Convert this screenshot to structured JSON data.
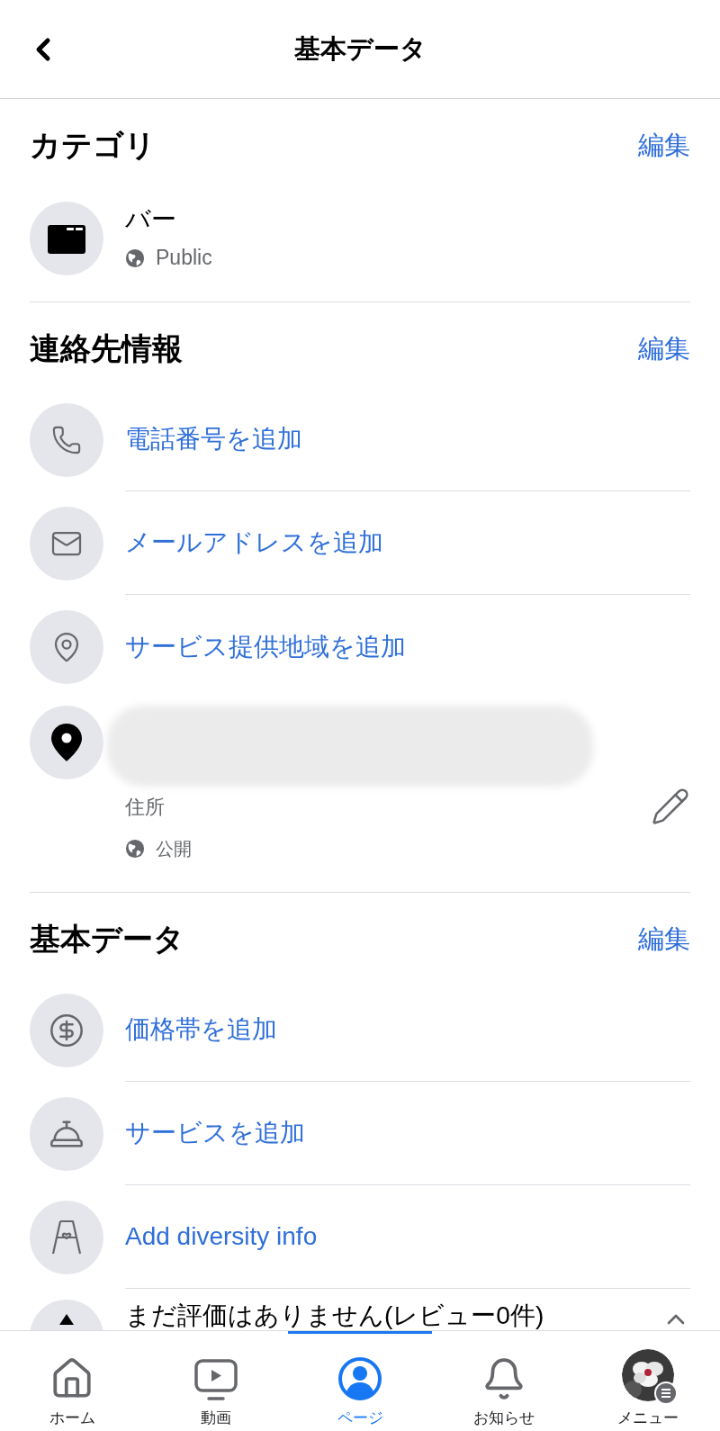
{
  "header": {
    "title": "基本データ"
  },
  "sections": [
    {
      "title": "カテゴリ",
      "action": "編集",
      "items": [
        {
          "kind": "category",
          "label": "バー",
          "privacy": "Public"
        }
      ]
    },
    {
      "title": "連絡先情報",
      "action": "編集",
      "items": [
        {
          "kind": "add",
          "label": "電話番号を追加"
        },
        {
          "kind": "add",
          "label": "メールアドレスを追加"
        },
        {
          "kind": "add",
          "label": "サービス提供地域を追加"
        },
        {
          "kind": "address",
          "sublabel": "住所",
          "privacy": "公開"
        }
      ]
    },
    {
      "title": "基本データ",
      "action": "編集",
      "items": [
        {
          "kind": "add",
          "label": "価格帯を追加"
        },
        {
          "kind": "add",
          "label": "サービスを追加"
        },
        {
          "kind": "add",
          "label": "Add diversity info"
        },
        {
          "kind": "rating",
          "label": "まだ評価はありません(レビュー0件)",
          "expanded": true
        }
      ]
    }
  ],
  "tabs": [
    {
      "label": "ホーム",
      "selected": false
    },
    {
      "label": "動画",
      "selected": false
    },
    {
      "label": "ページ",
      "selected": true
    },
    {
      "label": "お知らせ",
      "selected": false
    },
    {
      "label": "メニュー",
      "selected": false
    }
  ]
}
